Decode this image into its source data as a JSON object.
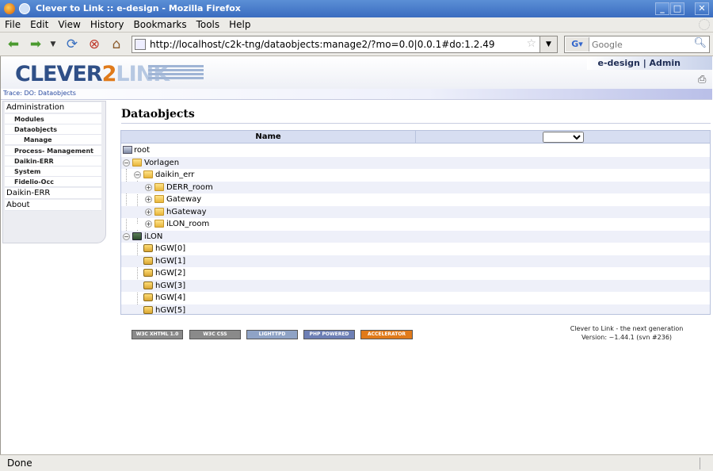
{
  "window": {
    "title": "Clever to Link :: e-design - Mozilla Firefox",
    "min": "_",
    "max": "□",
    "close": "✕"
  },
  "menu": [
    "File",
    "Edit",
    "View",
    "History",
    "Bookmarks",
    "Tools",
    "Help"
  ],
  "toolbar": {
    "url": "http://localhost/c2k-tng/dataobjects:manage2/?mo=0.0|0.0.1#do:1.2.49",
    "search_placeholder": "Google",
    "search_engine": "G"
  },
  "header": {
    "logo_part1": "CLEVER",
    "logo_part2": "2",
    "logo_part3": "LINK",
    "user": "e-design | Admin",
    "trace": "Trace: DO: Dataobjects"
  },
  "sidebar": {
    "items": [
      {
        "label": "Administration",
        "level": 1
      },
      {
        "label": "Modules",
        "level": 2
      },
      {
        "label": "Dataobjects",
        "level": 2
      },
      {
        "label": "Manage",
        "level": 3
      },
      {
        "label": "Process- Management",
        "level": 2
      },
      {
        "label": "Daikin-ERR",
        "level": 2
      },
      {
        "label": "System",
        "level": 2
      },
      {
        "label": "Fidelio-Occ",
        "level": 2
      },
      {
        "label": "Daikin-ERR",
        "level": 1
      },
      {
        "label": "About",
        "level": 1
      }
    ]
  },
  "content": {
    "title": "Dataobjects",
    "column_name": "Name",
    "tree": [
      {
        "label": "root",
        "depth": 0,
        "icon": "root-icon",
        "toggle": ""
      },
      {
        "label": "Vorlagen",
        "depth": 0,
        "icon": "folder-open-icon",
        "toggle": "−"
      },
      {
        "label": "daikin_err",
        "depth": 1,
        "icon": "folder-open-icon",
        "toggle": "−"
      },
      {
        "label": "DERR_room",
        "depth": 2,
        "icon": "folder-icon",
        "toggle": "+"
      },
      {
        "label": "Gateway",
        "depth": 2,
        "icon": "folder-icon",
        "toggle": "+"
      },
      {
        "label": "hGateway",
        "depth": 2,
        "icon": "folder-icon",
        "toggle": "+"
      },
      {
        "label": "iLON_room",
        "depth": 2,
        "icon": "folder-icon",
        "toggle": "+"
      },
      {
        "label": "iLON",
        "depth": 0,
        "icon": "device-icon",
        "toggle": "−"
      },
      {
        "label": "hGW[0]",
        "depth": 1,
        "icon": "hgw-icon",
        "toggle": ""
      },
      {
        "label": "hGW[1]",
        "depth": 1,
        "icon": "hgw-icon",
        "toggle": ""
      },
      {
        "label": "hGW[2]",
        "depth": 1,
        "icon": "hgw-icon",
        "toggle": ""
      },
      {
        "label": "hGW[3]",
        "depth": 1,
        "icon": "hgw-icon",
        "toggle": ""
      },
      {
        "label": "hGW[4]",
        "depth": 1,
        "icon": "hgw-icon",
        "toggle": ""
      },
      {
        "label": "hGW[5]",
        "depth": 1,
        "icon": "hgw-icon",
        "toggle": ""
      }
    ]
  },
  "footer": {
    "badges": [
      {
        "label": "W3C XHTML 1.0",
        "color": "#8a8a8a"
      },
      {
        "label": "W3C CSS",
        "color": "#8a8a8a"
      },
      {
        "label": "LIGHTTPD",
        "color": "#8fa3c6"
      },
      {
        "label": "PHP POWERED",
        "color": "#6d7fb5"
      },
      {
        "label": "ACCELERATOR",
        "color": "#e07a1a"
      }
    ],
    "line1": "Clever to Link - the next generation",
    "line2": "Version: ~1.44.1 (svn #236)"
  },
  "status": "Done"
}
